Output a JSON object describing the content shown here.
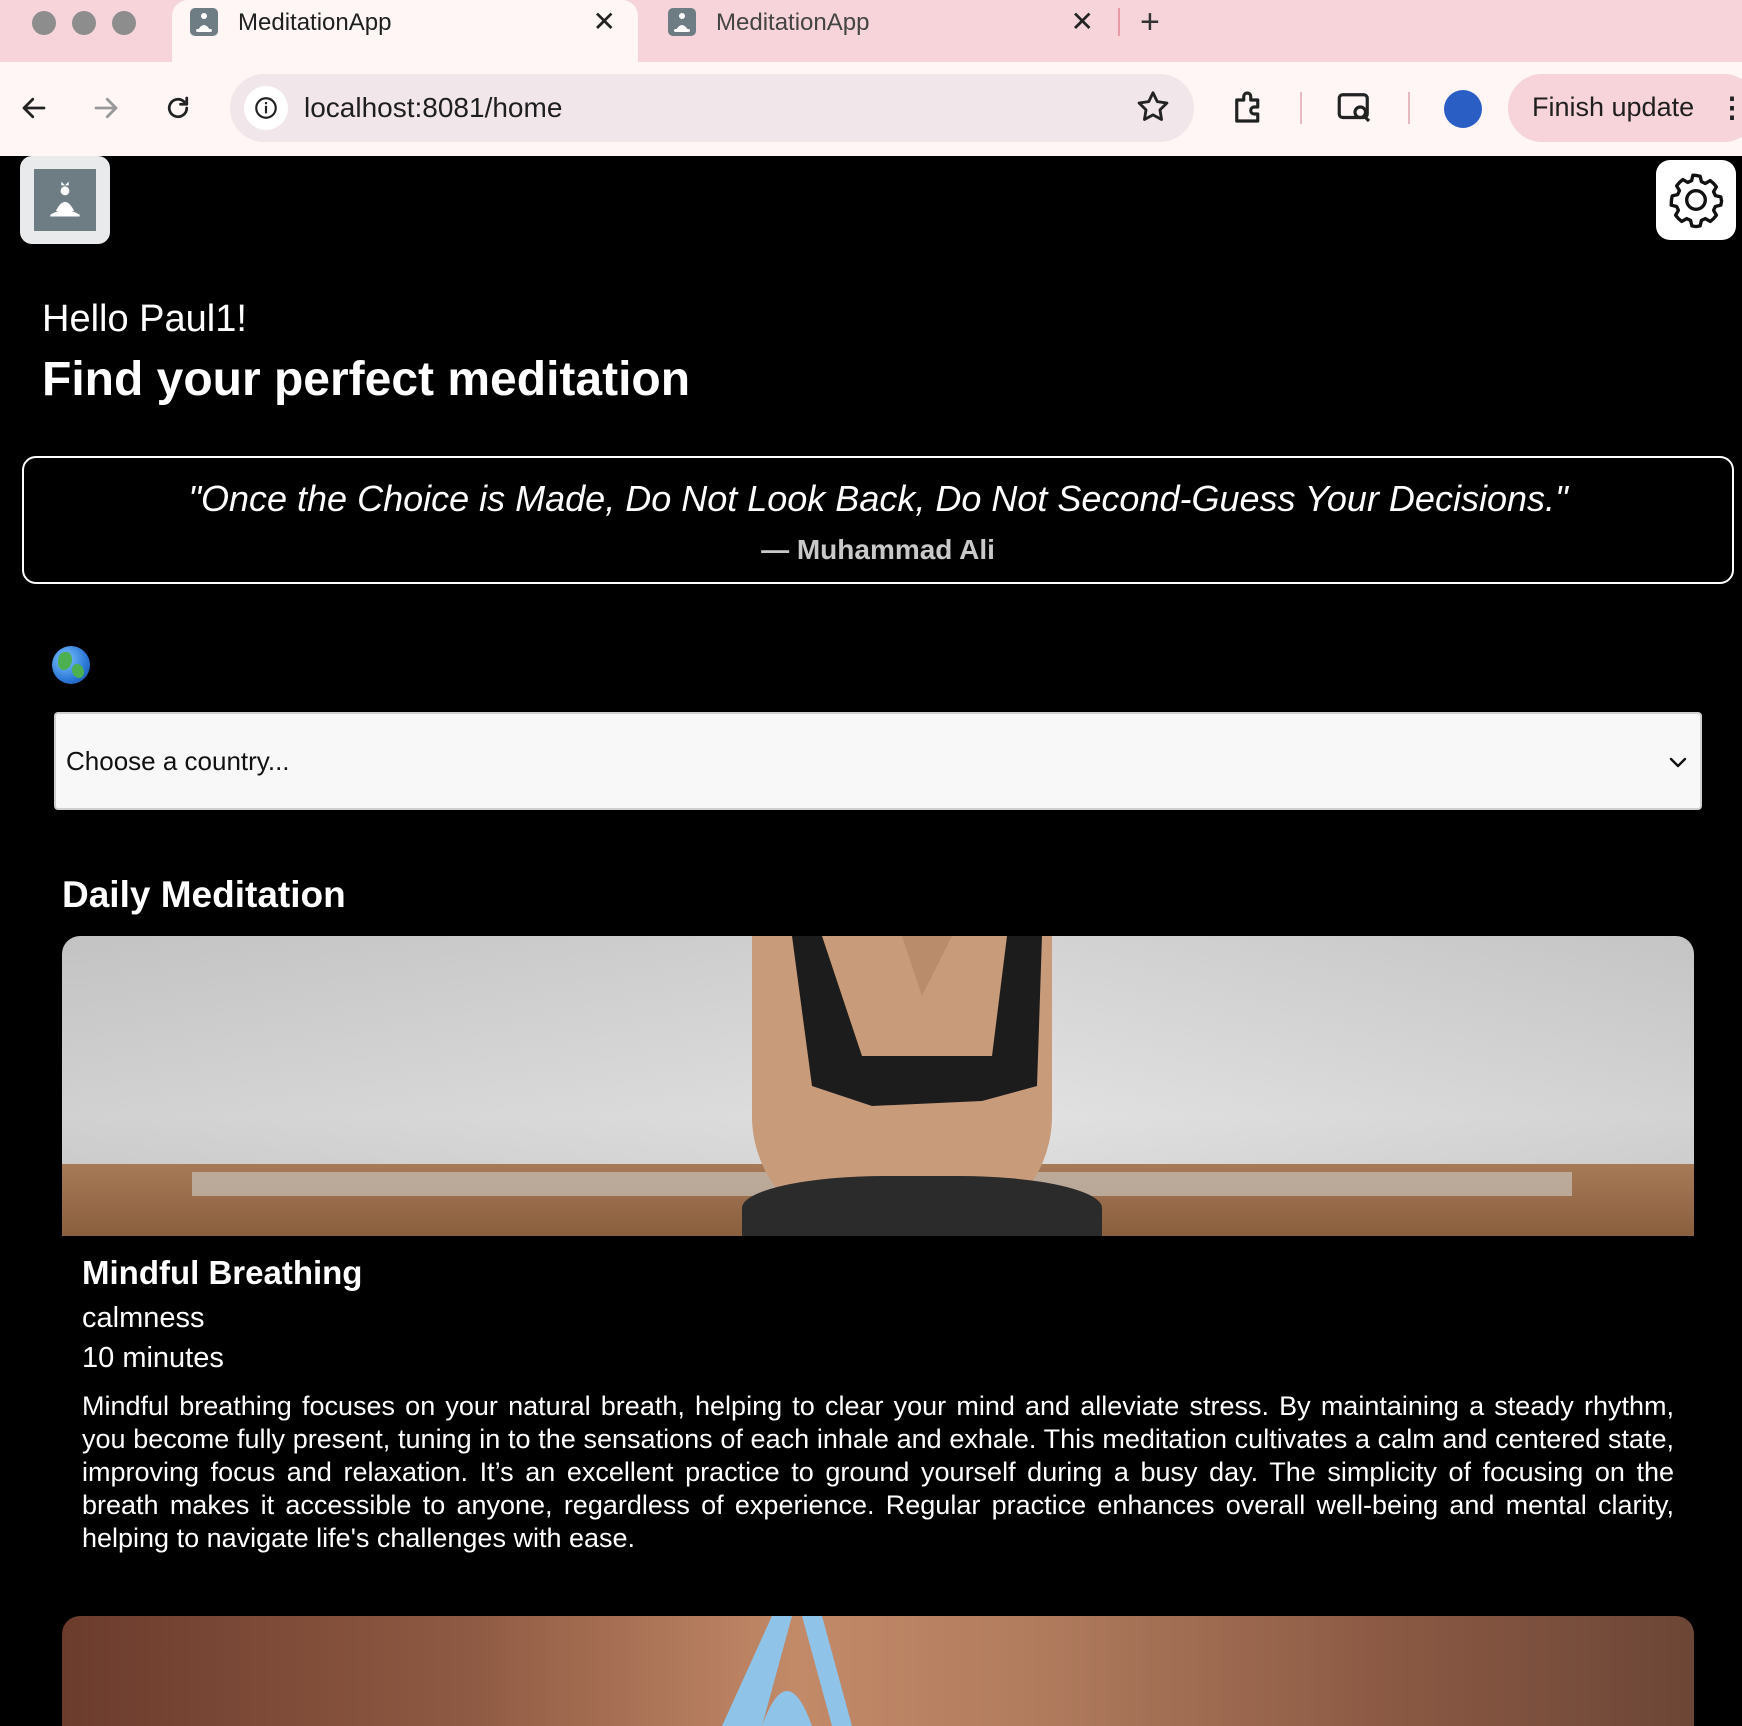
{
  "browser": {
    "tabs": [
      {
        "title": "MeditationApp",
        "active": true
      },
      {
        "title": "MeditationApp",
        "active": false
      }
    ],
    "tab_close_glyph": "✕",
    "new_tab_glyph": "+",
    "url": "localhost:8081/home",
    "finish_update_label": "Finish update",
    "kebab_glyph": "⋮",
    "accent_color": "#f6d4da"
  },
  "app": {
    "greeting": "Hello Paul1!",
    "headline": "Find your perfect meditation",
    "quote": {
      "text": "\"Once the Choice is Made, Do Not Look Back, Do Not Second-Guess Your Decisions.\"",
      "author": "— Muhammad Ali"
    },
    "globe_icon": "globe-icon",
    "country_select": {
      "selected": "Choose a country..."
    },
    "section_title": "Daily Meditation",
    "cards": [
      {
        "title": "Mindful Breathing",
        "tag": "calmness",
        "duration": "10 minutes",
        "description": "Mindful breathing focuses on your natural breath, helping to clear your mind and alleviate stress. By maintaining a steady rhythm, you become fully present, tuning in to the sensations of each inhale and exhale. This meditation cultivates a calm and centered state, improving focus and relaxation. It’s an excellent practice to ground yourself during a busy day. The simplicity of focusing on the breath makes it accessible to anyone, regardless of experience. Regular practice enhances overall well-being and mental clarity, helping to navigate life's challenges with ease."
      }
    ]
  }
}
